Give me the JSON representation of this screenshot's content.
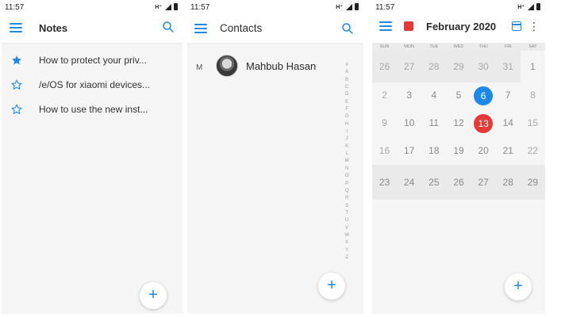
{
  "status": {
    "time": "11:57",
    "network": "H⁺"
  },
  "notes": {
    "title": "Notes",
    "items": [
      {
        "text": "How to protect your priv...",
        "starred": true
      },
      {
        "text": "/e/OS for xiaomi devices...",
        "starred": false
      },
      {
        "text": "How to use the new inst...",
        "starred": false
      }
    ],
    "fab": "+"
  },
  "contacts": {
    "title": "Contacts",
    "section": "M",
    "contact_name": "Mahbub Hasan",
    "alphabet": [
      "#",
      "A",
      "B",
      "C",
      "D",
      "E",
      "F",
      "G",
      "H",
      "I",
      "J",
      "K",
      "L",
      "M",
      "N",
      "O",
      "P",
      "Q",
      "R",
      "S",
      "T",
      "U",
      "V",
      "W",
      "X",
      "Y",
      "Z"
    ],
    "fab": "+"
  },
  "calendar": {
    "title": "February 2020",
    "weekdays": [
      "SUN",
      "MON",
      "TUE",
      "WED",
      "THU",
      "FRI",
      "SAT"
    ],
    "weeks": [
      [
        "26",
        "27",
        "28",
        "29",
        "30",
        "31",
        "1"
      ],
      [
        "2",
        "3",
        "4",
        "5",
        "6",
        "7",
        "8"
      ],
      [
        "9",
        "10",
        "11",
        "12",
        "13",
        "14",
        "15"
      ],
      [
        "16",
        "17",
        "18",
        "19",
        "20",
        "21",
        "22"
      ],
      [
        "23",
        "24",
        "25",
        "26",
        "27",
        "28",
        "29"
      ]
    ],
    "selected_day": "6",
    "today": "13",
    "fab": "+"
  },
  "colors": {
    "accent": "#1e88e5",
    "today": "#e53935",
    "calendar_color": "#e53935"
  }
}
